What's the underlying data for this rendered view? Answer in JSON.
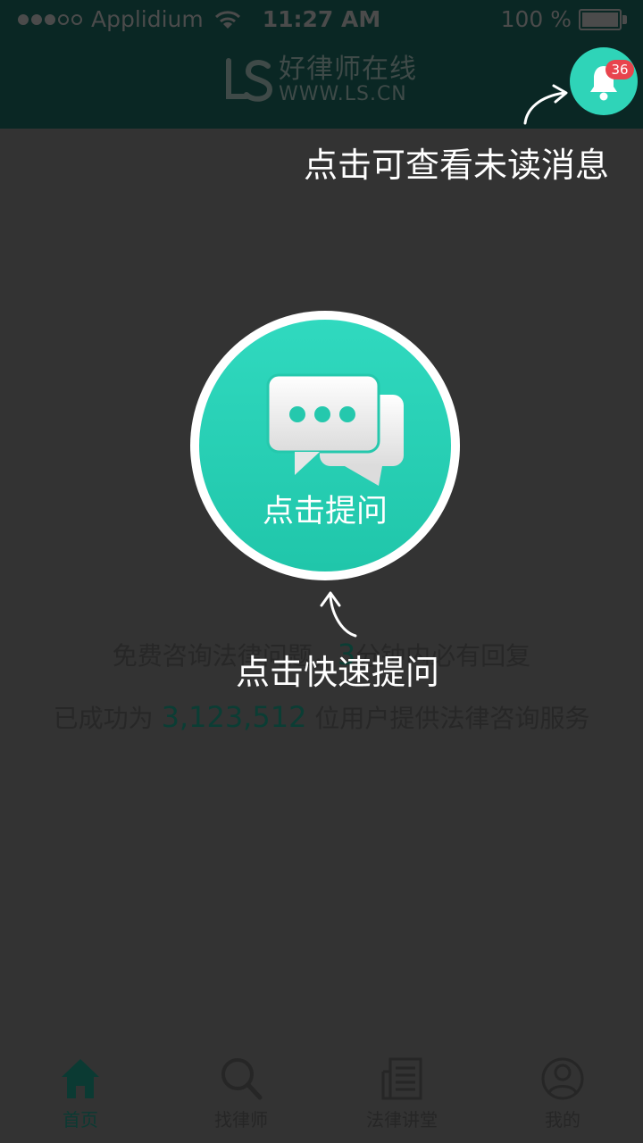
{
  "status_bar": {
    "carrier": "Applidium",
    "time": "11:27 AM",
    "battery": "100 %"
  },
  "header": {
    "logo_cn": "好律师在线",
    "logo_en": "WWW.LS.CN",
    "notification_badge": "36"
  },
  "guide": {
    "bell_tip": "点击可查看未读消息",
    "ask_tip": "点击快速提问"
  },
  "ask_button": {
    "label": "点击提问"
  },
  "info": {
    "line1_prefix": "免费咨询法律问题，",
    "line1_number": "3",
    "line1_suffix": "分钟内必有回复",
    "line2_prefix": "已成功为",
    "line2_number": "3,123,512",
    "line2_suffix": "位用户提供法律咨询服务"
  },
  "tabbar": {
    "items": [
      {
        "label": "首页",
        "icon": "home-icon",
        "active": true
      },
      {
        "label": "找律师",
        "icon": "search-icon",
        "active": false
      },
      {
        "label": "法律讲堂",
        "icon": "book-icon",
        "active": false
      },
      {
        "label": "我的",
        "icon": "user-icon",
        "active": false
      }
    ]
  },
  "colors": {
    "accent": "#2fd4b8",
    "header_bg": "#0a2724",
    "overlay_bg": "#333333",
    "badge": "#e8444d"
  }
}
